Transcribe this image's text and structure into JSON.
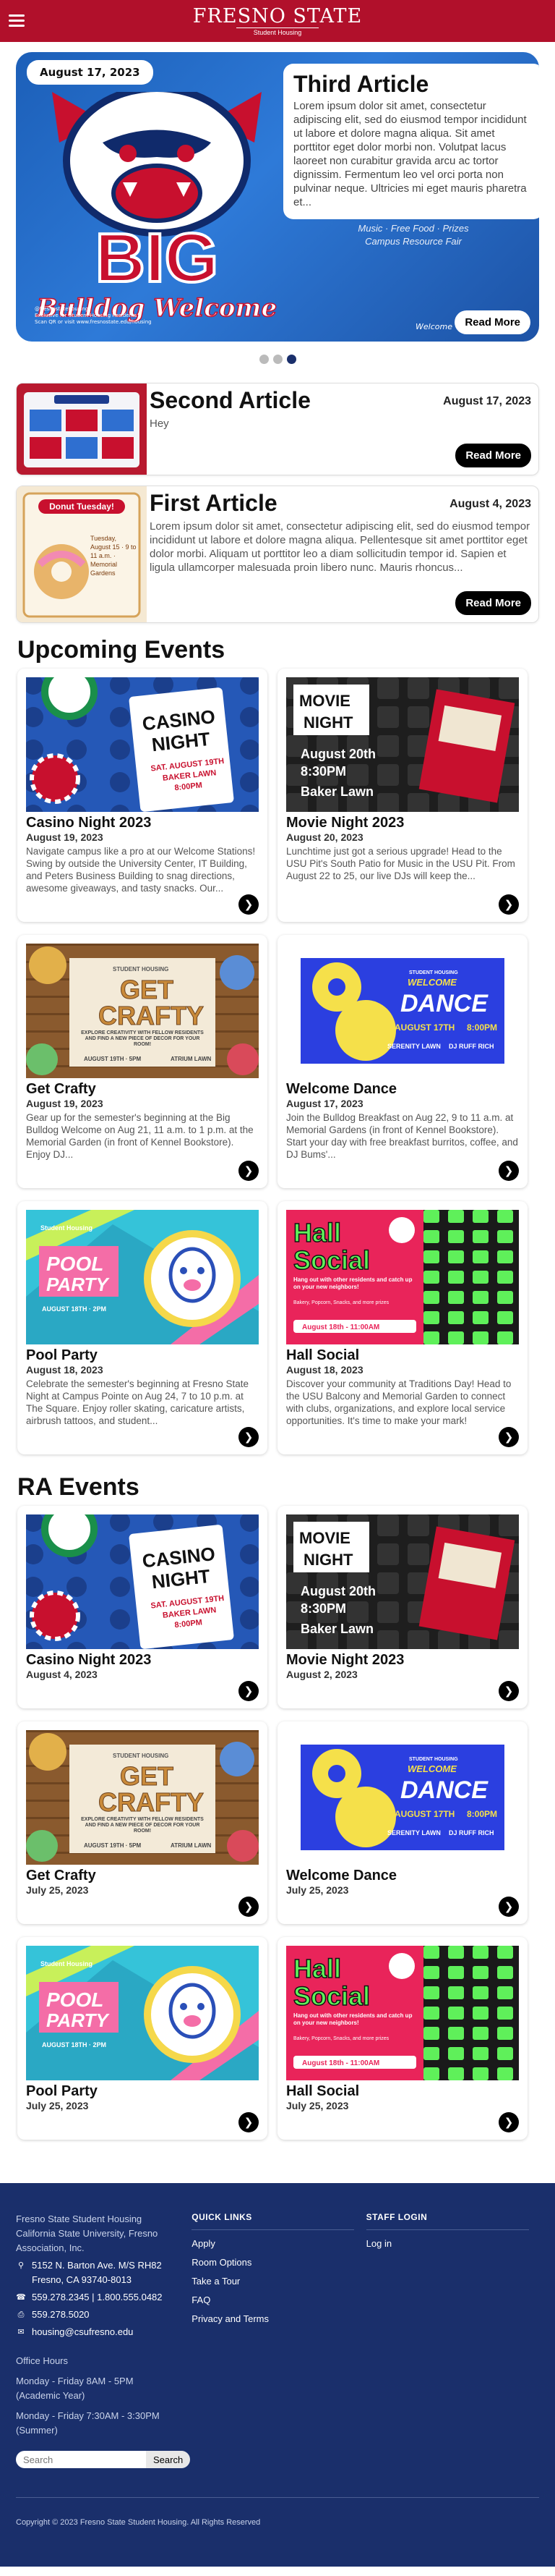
{
  "header": {
    "logo_line1": "FRESNO STATE",
    "logo_line2": "Student Housing",
    "menu_icon": "hamburger-icon"
  },
  "carousel": {
    "date": "August 17, 2023",
    "title": "Third Article",
    "text": "Lorem ipsum dolor sit amet, consectetur adipiscing elit, sed do eiusmod tempor incididunt ut labore et dolore magna aliqua. Sit amet porttitor eget dolor morbi non. Volutpat lacus laoreet non curabitur gravida arcu ac tortor dignissim. Fermentum leo vel orci porta non pulvinar neque. Ultricies mi eget mauris pharetra et...",
    "caption_line1": "Music · Free Food · Prizes",
    "caption_line2": "Campus Resource Fair",
    "read_more": "Read More",
    "image_word1": "BIG",
    "image_word2": "Bulldog Welcome",
    "image_small1": "@fresnostatehousing",
    "image_small2": "Exclusive for Student Housing Residents",
    "image_small3": "Scan QR or visit www.fresnostate.edu/housing",
    "image_sign": "Welcome",
    "dots": 3,
    "active_dot": 2
  },
  "articles": [
    {
      "title": "Second Article",
      "date": "August 17, 2023",
      "text": "Hey",
      "read_more": "Read More"
    },
    {
      "title": "First Article",
      "date": "August 4, 2023",
      "text": "Lorem ipsum dolor sit amet, consectetur adipiscing elit, sed do eiusmod tempor incididunt ut labore et dolore magna aliqua. Pellentesque sit amet porttitor eget dolor morbi. Aliquam ut porttitor leo a diam sollicitudin tempor id. Sapien et ligula ullamcorper malesuada proin libero nunc. Mauris rhoncus...",
      "read_more": "Read More",
      "img_text1": "Donut Tuesday!",
      "img_text2": "Tuesday, August 15 · 9 to 11 a.m. · Memorial Gardens"
    }
  ],
  "upcoming": {
    "title": "Upcoming Events",
    "events": [
      {
        "title": "Casino Night 2023",
        "date": "August 19, 2023",
        "text": "Navigate campus like a pro at our Welcome Stations! Swing by outside the University Center, IT Building, and Peters Business Building to snag directions, awesome giveaways, and tasty snacks. Our..."
      },
      {
        "title": "Movie Night 2023",
        "date": "August 20, 2023",
        "text": "Lunchtime just got a serious upgrade! Head to the USU Pit's South Patio for Music in the USU Pit. From August 22 to 25, our live DJs will keep the..."
      },
      {
        "title": "Get Crafty",
        "date": "August 19, 2023",
        "text": "Gear up for the semester's beginning at the Big Bulldog Welcome on Aug 21, 11 a.m. to 1 p.m. at the Memorial Garden (in front of Kennel Bookstore). Enjoy DJ..."
      },
      {
        "title": "Welcome Dance",
        "date": "August 17, 2023",
        "text": "Join the Bulldog Breakfast on Aug 22, 9 to 11 a.m. at Memorial Gardens (in front of Kennel Bookstore). Start your day with free breakfast burritos, coffee, and DJ Bums'..."
      },
      {
        "title": "Pool Party",
        "date": "August 18, 2023",
        "text": "Celebrate the semester's beginning at Fresno State Night at Campus Pointe on Aug 24, 7 to 10 p.m. at The Square. Enjoy roller skating, caricature artists, airbrush tattoos, and student..."
      },
      {
        "title": "Hall Social",
        "date": "August 18, 2023",
        "text": "Discover your community at Traditions Day! Head to the USU Balcony and Memorial Garden to connect with clubs, organizations, and explore local service opportunities. It's time to make your mark!"
      }
    ]
  },
  "ra": {
    "title": "RA Events",
    "events": [
      {
        "title": "Casino Night 2023",
        "date": "August 4, 2023"
      },
      {
        "title": "Movie Night 2023",
        "date": "August 2, 2023"
      },
      {
        "title": "Get Crafty",
        "date": "July 25, 2023"
      },
      {
        "title": "Welcome Dance",
        "date": "July 25, 2023"
      },
      {
        "title": "Pool Party",
        "date": "July 25, 2023"
      },
      {
        "title": "Hall Social",
        "date": "July 25, 2023"
      }
    ]
  },
  "posters": {
    "casino": {
      "l1": "CASINO",
      "l2": "NIGHT",
      "l3": "SAT. AUGUST 19TH",
      "l4": "BAKER LAWN",
      "l5": "8:00PM"
    },
    "movie": {
      "l1": "MOVIE",
      "l2": "NIGHT",
      "l3": "August 20th",
      "l4": "8:30PM",
      "l5": "Baker Lawn"
    },
    "crafty": {
      "l1": "STUDENT HOUSING",
      "l2": "GET",
      "l3": "CRAFTY",
      "l4": "EXPLORE CREATIVITY WITH FELLOW RESIDENTS AND FIND A NEW PIECE OF DECOR FOR YOUR ROOM!",
      "l5": "AUGUST 19TH · 5PM",
      "l6": "ATRIUM LAWN"
    },
    "dance": {
      "l1": "STUDENT HOUSING",
      "l2": "WELCOME",
      "l3": "DANCE",
      "l4": "AUGUST 17TH",
      "l5": "8:00PM",
      "l6": "SERENITY LAWN",
      "l7": "DJ RUFF RICH"
    },
    "pool": {
      "l1": "Student Housing",
      "l2": "POOL",
      "l3": "PARTY",
      "l4": "AUGUST 18TH · 2PM"
    },
    "hall": {
      "l1": "Hall",
      "l2": "Social",
      "l3": "Hang out with other residents and catch up on your new neighbors!",
      "l4": "Bakery, Popcorn, Snacks, and more prizes",
      "l5": "August 18th - 11:00AM"
    }
  },
  "footer": {
    "org1": "Fresno State Student Housing",
    "org2": "California State University, Fresno Association, Inc.",
    "address1": "5152 N. Barton Ave. M/S RH82",
    "address2": "Fresno, CA 93740-8013",
    "phone": "559.278.2345",
    "phone2": "1.800.555.0482",
    "fax": "559.278.5020",
    "email": "housing@csufresno.edu",
    "hours_title": "Office Hours",
    "hours1": "Monday - Friday 8AM - 5PM",
    "hours1b": "(Academic Year)",
    "hours2": "Monday - Friday 7:30AM - 3:30PM",
    "hours2b": "(Summer)",
    "search_placeholder": "Search",
    "search_button": "Search",
    "quick_title": "QUICK LINKS",
    "quick": [
      "Apply",
      "Room Options",
      "Take a Tour",
      "FAQ",
      "Privacy and Terms"
    ],
    "staff_title": "STAFF LOGIN",
    "staff": [
      "Log in"
    ],
    "copyright": "Copyright © 2023 Fresno State Student Housing. All Rights Reserved"
  }
}
